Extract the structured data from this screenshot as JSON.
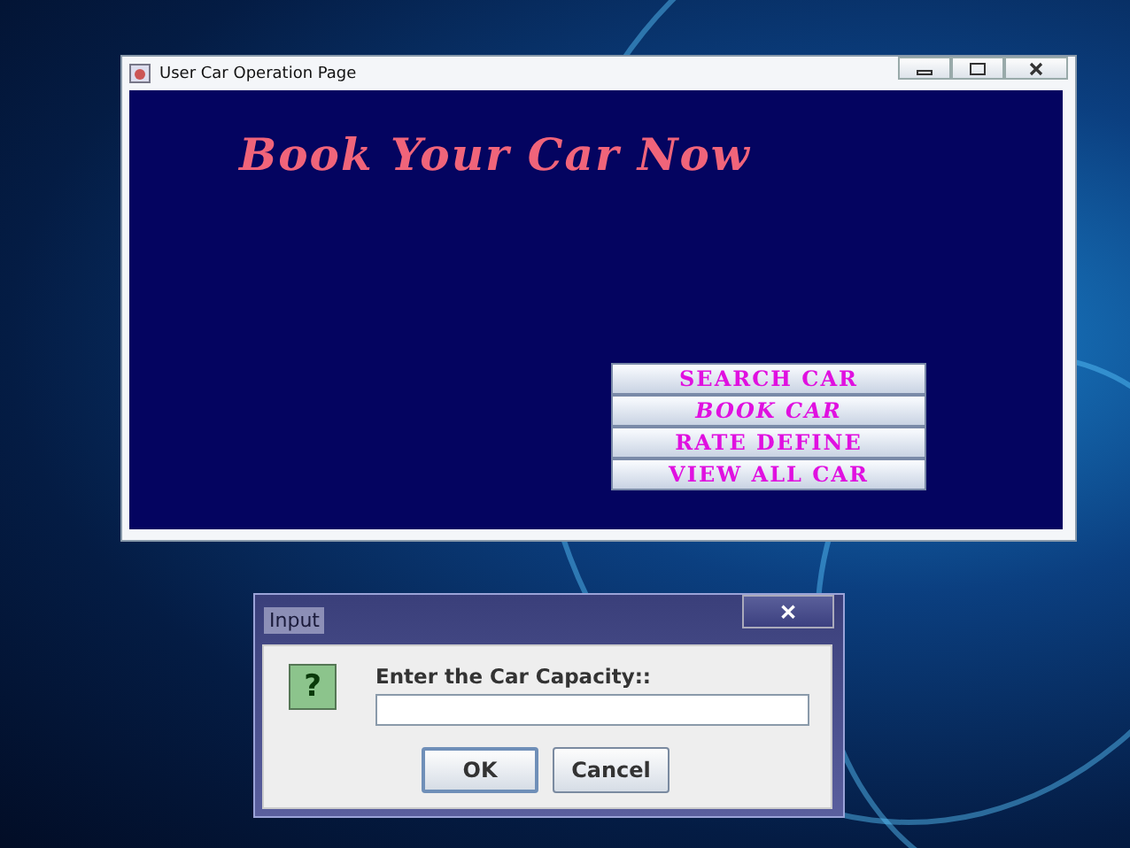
{
  "main_window": {
    "title": "User Car Operation Page",
    "heading": "Book Your Car Now",
    "menu_buttons": [
      {
        "label": "SEARCH CAR",
        "selected": false
      },
      {
        "label": "BOOK CAR",
        "selected": true
      },
      {
        "label": "RATE DEFINE",
        "selected": false
      },
      {
        "label": "VIEW ALL CAR",
        "selected": false
      }
    ]
  },
  "dialog": {
    "title": "Input",
    "prompt": "Enter the Car Capacity::",
    "close_glyph": "✕",
    "icon_glyph": "?",
    "buttons": [
      "OK",
      "Cancel"
    ]
  }
}
